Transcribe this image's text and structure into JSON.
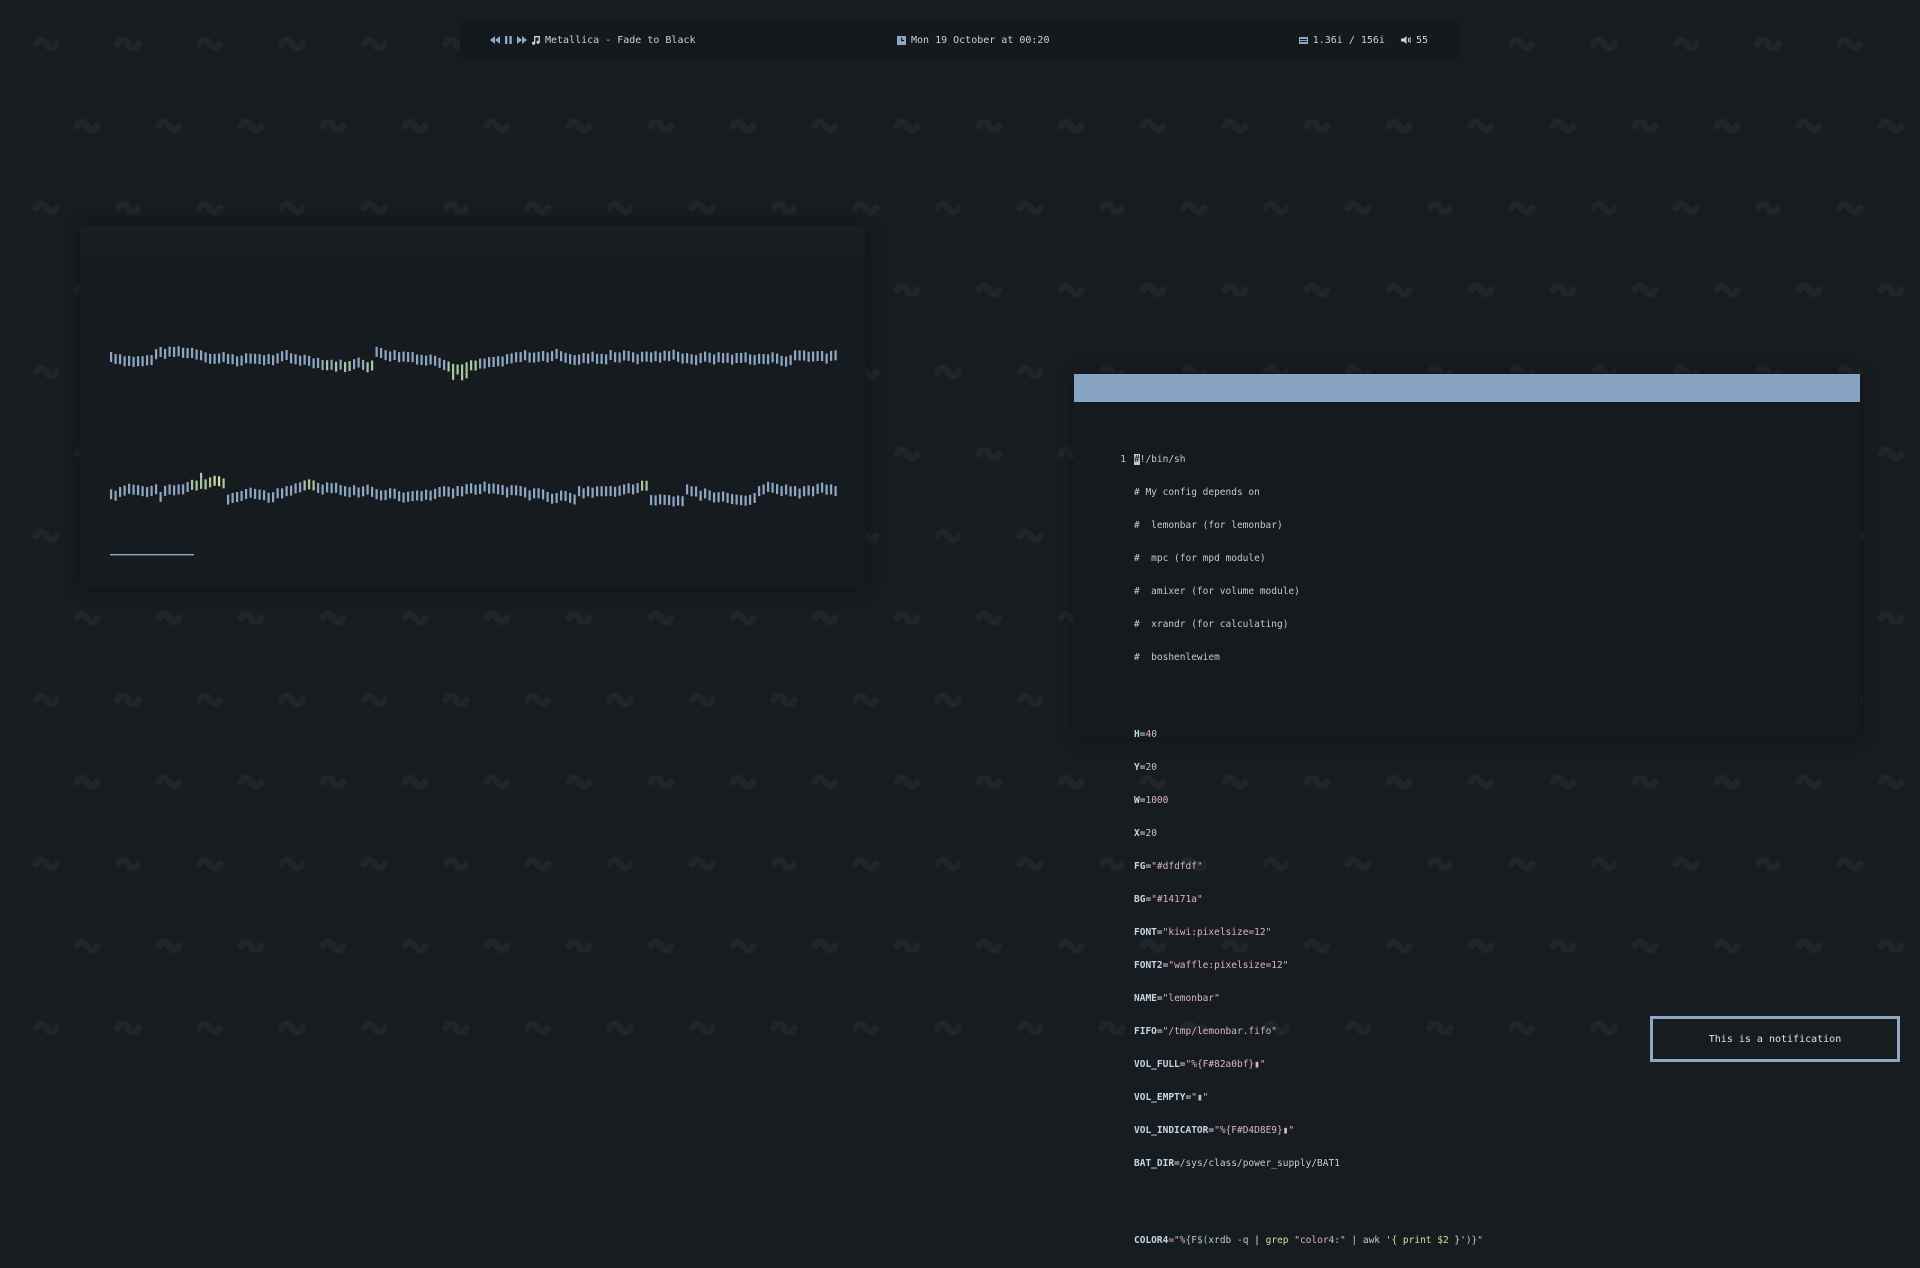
{
  "bar": {
    "track": "Metallica - Fade to Black",
    "datetime": "Mon 19 October at 00:20",
    "memory": "1.36i / 156i",
    "volume": "55"
  },
  "editor": {
    "first_line_number": "1",
    "shebang_first_char": "#",
    "shebang_rest": "!/bin/sh",
    "comments": [
      "# My config depends on",
      "#  lemonbar (for lemonbar)",
      "#  mpc (for mpd module)",
      "#  amixer (for volume module)",
      "#  xrandr (for calculating)",
      "#  boshenlewiem"
    ],
    "vars": [
      {
        "name": "H",
        "value": "40"
      },
      {
        "name": "Y",
        "value": "20"
      },
      {
        "name": "W",
        "value": "1000"
      },
      {
        "name": "X",
        "value": "20"
      },
      {
        "name": "FG",
        "value": "\"#dfdfdf\""
      },
      {
        "name": "BG",
        "value": "\"#14171a\""
      },
      {
        "name": "FONT",
        "value": "\"kiwi:pixelsize=12\""
      },
      {
        "name": "FONT2",
        "value": "\"waffle:pixelsize=12\""
      },
      {
        "name": "NAME",
        "value": "\"lemonbar\""
      },
      {
        "name": "FIFO",
        "value": "\"/tmp/lemonbar.fifo\""
      },
      {
        "name": "VOL_FULL",
        "value": "\"%{F#82a0bf}▮\""
      },
      {
        "name": "VOL_EMPTY",
        "value": "\"▮\""
      },
      {
        "name": "VOL_INDICATOR",
        "value": "\"%{F#D4D8E9}▮\""
      },
      {
        "name": "BAT_DIR",
        "value": "/sys/class/power_supply/BAT1"
      }
    ],
    "color_line": {
      "name": "COLOR4",
      "a": "=\"%{F",
      "b": "$(",
      "c": "xrdb -q",
      "d": " | ",
      "e": "grep",
      "f": " \"color4:\" ",
      "g": "| awk ",
      "h": "'{ print $2 }'",
      "i": ")}\""
    }
  },
  "notification": {
    "text": "This is a notification"
  },
  "colors": {
    "background": "#171c21",
    "bar": "#14191d",
    "accent": "#88a4c3",
    "wave_blue": "#8da7c5",
    "wave_green": "#a9c7a0",
    "wave_yellow": "#e1d8a6"
  },
  "icons": [
    "rewind-icon",
    "pause-icon",
    "forward-icon",
    "music-note-icon",
    "clock-icon",
    "memory-icon",
    "speaker-icon"
  ]
}
